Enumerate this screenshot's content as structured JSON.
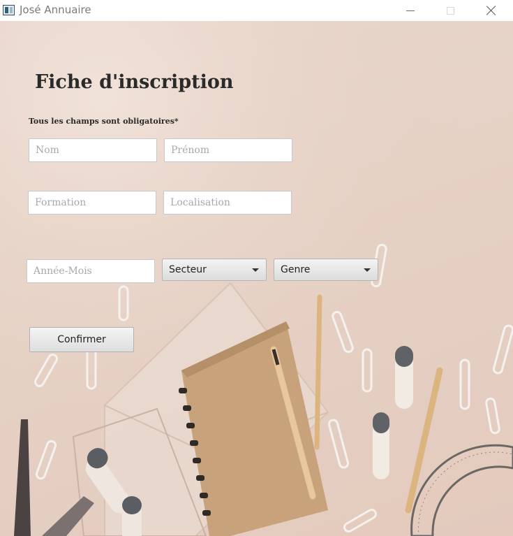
{
  "window": {
    "title": "José Annuaire",
    "icon": "app-window-icon",
    "controls": [
      "minimize-icon",
      "maximize-icon",
      "close-icon"
    ]
  },
  "form": {
    "title": "Fiche d'inscription",
    "note": "Tous les champs sont obligatoires*",
    "fields": {
      "nom": {
        "value": "",
        "placeholder": "Nom"
      },
      "prenom": {
        "value": "",
        "placeholder": "Prénom"
      },
      "formation": {
        "value": "",
        "placeholder": "Formation"
      },
      "localisation": {
        "value": "",
        "placeholder": "Localisation"
      },
      "annee_mois": {
        "value": "",
        "placeholder": "Année-Mois"
      }
    },
    "selects": {
      "secteur": {
        "selected": "Secteur"
      },
      "genre": {
        "selected": "Genre"
      }
    },
    "confirm_label": "Confirmer"
  },
  "background": {
    "description_colors": {
      "base": "#e6d2c6",
      "notebook": "#c9a57a",
      "pencil": "#d9b07a",
      "eraser_gray": "#6b6e72"
    }
  }
}
